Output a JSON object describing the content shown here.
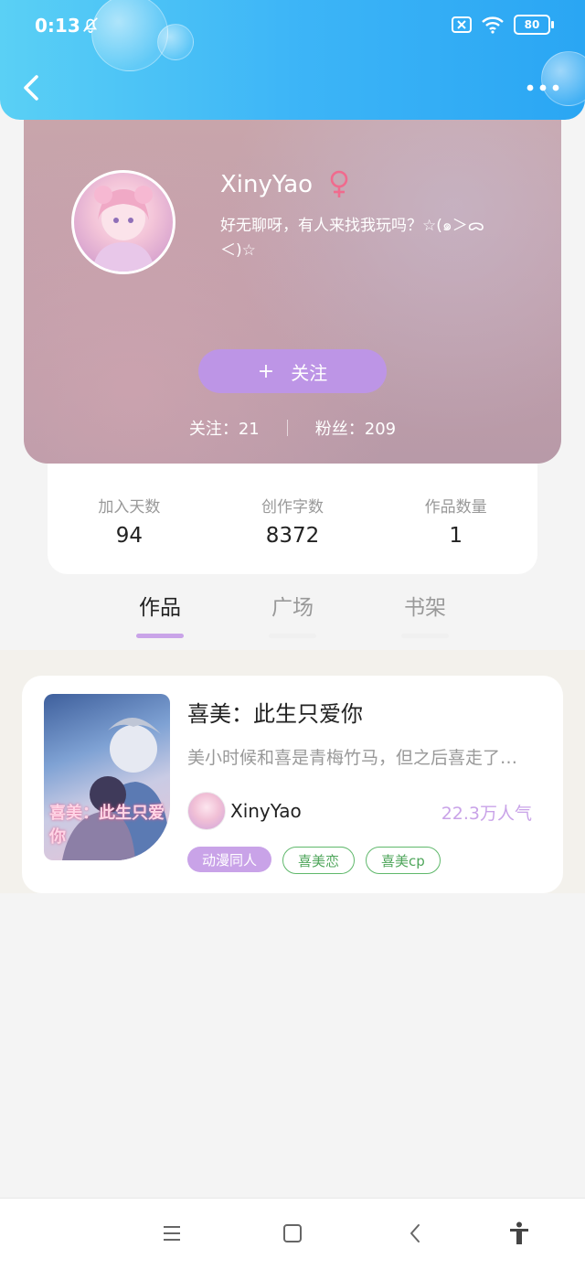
{
  "status_bar": {
    "time": "0:13",
    "battery": "80"
  },
  "profile": {
    "username": "XinyYao",
    "gender_symbol": "♀",
    "bio": "好无聊呀，有人来找我玩吗？☆(๑＞ᯅ＜)☆",
    "follow_button": {
      "plus": "+",
      "label": "关注"
    },
    "following_text": "关注：21",
    "fans_text": "粉丝：209"
  },
  "stats": [
    {
      "label": "加入天数",
      "value": "94"
    },
    {
      "label": "创作字数",
      "value": "8372"
    },
    {
      "label": "作品数量",
      "value": "1"
    }
  ],
  "tabs": [
    {
      "label": "作品",
      "active": true
    },
    {
      "label": "广场",
      "active": false
    },
    {
      "label": "书架",
      "active": false
    }
  ],
  "work": {
    "title": "喜美：此生只爱你",
    "description": "美小时候和喜是青梅竹马，但之后喜走了…",
    "author": "XinyYao",
    "popularity": "22.3万人气",
    "cover_text": "喜美：此生只爱你",
    "tags": [
      "动漫同人",
      "喜美恋",
      "喜美cp"
    ]
  },
  "colors": {
    "header": "#3db5f7",
    "accent": "#c9a3e8",
    "tag_green": "#5fb86b"
  }
}
